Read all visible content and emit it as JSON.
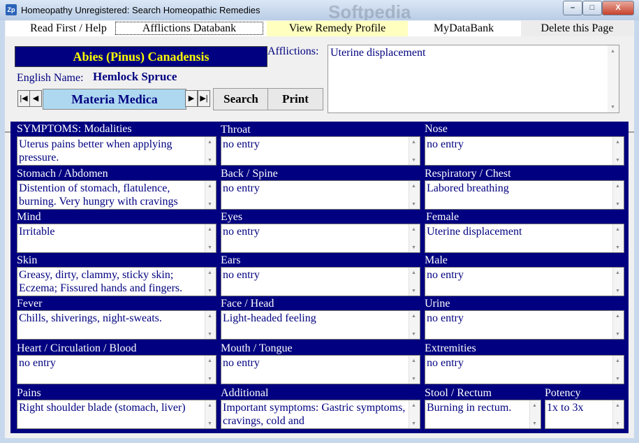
{
  "window": {
    "title": "Homeopathy Unregistered: Search Homeopathic Remedies",
    "watermark": "Softpedia",
    "icon_text": "Zp",
    "controls": {
      "minimize": "–",
      "maximize": "□",
      "close": "X"
    }
  },
  "menu": [
    {
      "label": "Read First / Help"
    },
    {
      "label": "Afflictions Databank"
    },
    {
      "label": "View Remedy Profile"
    },
    {
      "label": "MyDataBank"
    },
    {
      "label": "Delete this Page"
    }
  ],
  "remedy": {
    "name": "Abies (Pinus) Canadensis",
    "english_label": "English Name:",
    "english_name": "Hemlock Spruce"
  },
  "nav": {
    "first": "|◀",
    "prev": "◀",
    "caption": "Materia Medica",
    "next": "▶",
    "last": "▶|"
  },
  "buttons": {
    "search": "Search",
    "print": "Print"
  },
  "afflictions": {
    "label": "Afflictions:",
    "value": "Uterine displacement"
  },
  "fields": [
    {
      "label": "SYMPTOMS: Modalities",
      "value": "Uterus pains better when applying pressure."
    },
    {
      "label": "Throat",
      "value": "no entry"
    },
    {
      "label": "Nose",
      "value": "no entry"
    },
    {
      "label": "Stomach / Abdomen",
      "value": "Distention of stomach, flatulence, burning. Very hungry with cravings"
    },
    {
      "label": "Back / Spine",
      "value": "no entry"
    },
    {
      "label": "Respiratory / Chest",
      "value": "Labored breathing"
    },
    {
      "label": "Mind",
      "value": "Irritable"
    },
    {
      "label": "Eyes",
      "value": "no entry"
    },
    {
      "label": "Female",
      "value": "Uterine displacement"
    },
    {
      "label": "Skin",
      "value": "Greasy, dirty, clammy, sticky skin; Eczema; Fissured hands and fingers."
    },
    {
      "label": "Ears",
      "value": "no entry"
    },
    {
      "label": "Male",
      "value": "no entry"
    },
    {
      "label": "Fever",
      "value": "Chills, shiverings, night-sweats."
    },
    {
      "label": "Face / Head",
      "value": "Light-headed feeling"
    },
    {
      "label": "Urine",
      "value": "no entry"
    },
    {
      "label": "Heart / Circulation / Blood",
      "value": "no entry"
    },
    {
      "label": "Mouth / Tongue",
      "value": "no entry"
    },
    {
      "label": "Extremities",
      "value": "no entry"
    },
    {
      "label": "Pains",
      "value": "Right shoulder blade (stomach, liver)"
    },
    {
      "label": "Additional",
      "value": "Important symptoms: Gastric symptoms, cravings, cold and"
    },
    {
      "label": "Stool / Rectum",
      "value": "Burning in rectum."
    },
    {
      "label": "Potency",
      "value": "1x to 3x"
    }
  ],
  "colors": {
    "panel": "#000080",
    "remedy_title": "#ffff00",
    "accent_text": "#000080",
    "nav_caption_bg": "#add8f0",
    "remedy_tab_bg": "#ffffc0"
  }
}
